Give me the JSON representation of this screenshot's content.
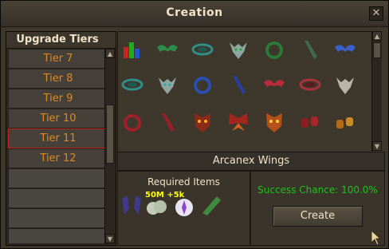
{
  "window": {
    "title": "Creation",
    "close": "✕"
  },
  "tiers": {
    "header": "Upgrade Tiers",
    "items": [
      {
        "label": "Tier 7",
        "selected": false
      },
      {
        "label": "Tier 8",
        "selected": false
      },
      {
        "label": "Tier 9",
        "selected": false
      },
      {
        "label": "Tier 10",
        "selected": false
      },
      {
        "label": "Tier 11",
        "selected": true
      },
      {
        "label": "Tier 12",
        "selected": false
      }
    ]
  },
  "item_grid": {
    "rows": [
      [
        "stats-chart",
        "green-wings",
        "teal-swirl",
        "teal-mask",
        "green-ring",
        "green-shard",
        "blue-wings"
      ],
      [
        "teal-swirl",
        "teal-mask",
        "blue-ring",
        "blue-shard",
        "red-wings",
        "red-swirl",
        "white-mask"
      ],
      [
        "red-ring",
        "red-shard",
        "red-demon-mask",
        "red-butterfly",
        "red-demon-mask",
        "red-gloves",
        "orange-gloves"
      ]
    ]
  },
  "selected_item": {
    "name": "Arcanex Wings"
  },
  "required": {
    "label": "Required Items",
    "quantity": "50M +5k",
    "items": [
      "purple-wings",
      "essence-cloud",
      "prism-star",
      "green-crystal"
    ]
  },
  "success": {
    "label": "Success Chance: 100.0%"
  },
  "actions": {
    "create_label": "Create"
  },
  "colors": {
    "tier_text": "#e0891b",
    "success_text": "#1ec21e",
    "selected_border": "#c0241a"
  }
}
